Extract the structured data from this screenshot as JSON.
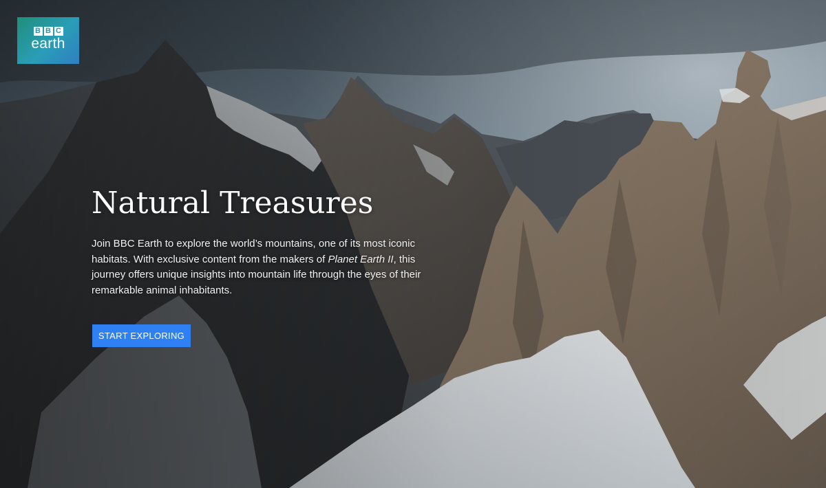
{
  "logo": {
    "letters": [
      "B",
      "B",
      "C"
    ],
    "word": "earth"
  },
  "hero": {
    "title": "Natural Treasures",
    "description_before": "Join BBC Earth to explore the world’s mountains, one of its most iconic habitats. With exclusive content from the makers of ",
    "description_italic": "Planet Earth II",
    "description_after": ", this journey offers unique insights into mountain life through the eyes of their remarkable animal inhabitants.",
    "cta_label": "START EXPLORING"
  },
  "colors": {
    "cta_background": "#2f80f3",
    "logo_gradient_start": "#1f8f7a",
    "logo_gradient_end": "#2f7fc2"
  },
  "background": {
    "image": "snowy mountain ridge photograph"
  }
}
